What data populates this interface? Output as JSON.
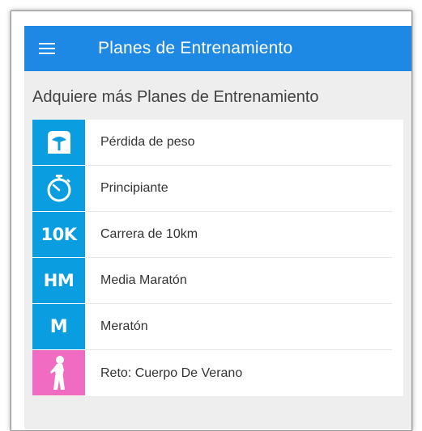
{
  "app_bar": {
    "title": "Planes de Entrenamiento",
    "menu_icon": "hamburger-menu-icon",
    "color": "#1e88e5"
  },
  "section": {
    "title": "Adquiere más Planes de Entrenamiento"
  },
  "plans": [
    {
      "label": "Pérdida de peso",
      "icon": "scale-icon",
      "icon_text": "",
      "icon_color": "#0a9ee0"
    },
    {
      "label": "Principiante",
      "icon": "stopwatch-icon",
      "icon_text": "",
      "icon_color": "#0a9ee0"
    },
    {
      "label": "Carrera de 10km",
      "icon": "10k-icon",
      "icon_text": "10K",
      "icon_color": "#0a9ee0"
    },
    {
      "label": "Media Maratón",
      "icon": "half-marathon-icon",
      "icon_text": "HM",
      "icon_color": "#0a9ee0"
    },
    {
      "label": "Meratón",
      "icon": "marathon-icon",
      "icon_text": "M",
      "icon_color": "#0a9ee0"
    },
    {
      "label": "Reto: Cuerpo De Verano",
      "icon": "summer-body-icon",
      "icon_text": "",
      "icon_color": "#f06cc3"
    }
  ]
}
